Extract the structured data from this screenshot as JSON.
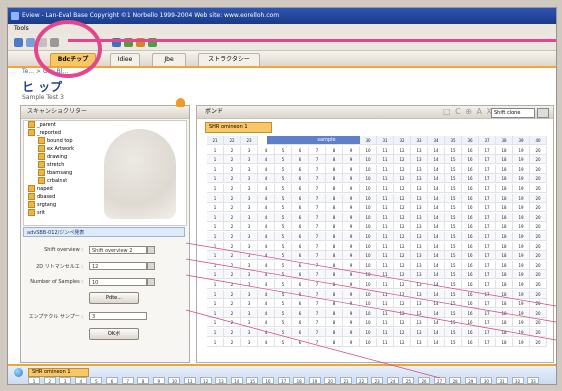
{
  "window": {
    "title": "Eview - Lan-Eval Base  Copyright ©1 Norbello 1999-2004  Web site: www.eorelloh.com"
  },
  "menu": {
    "items": [
      "Tools"
    ]
  },
  "tabs": [
    {
      "label": "Bdcチップ",
      "active": true
    },
    {
      "label": "Idiee",
      "active": false
    },
    {
      "label": "Jbe",
      "active": false
    },
    {
      "label": "ストラクタシー",
      "active": false
    }
  ],
  "breadcrumb": "Te... > Gov Bl...",
  "page": {
    "title": "ヒ ップ",
    "subtitle": "Sample Test 3"
  },
  "left_panel": {
    "header": "スキャンショクリター",
    "tree": [
      {
        "label": "_parent",
        "indent": 0
      },
      {
        "label": "_reported",
        "indent": 0
      },
      {
        "label": "bound top",
        "indent": 1
      },
      {
        "label": "ex Artwork",
        "indent": 1
      },
      {
        "label": "drawing",
        "indent": 1
      },
      {
        "label": "stretch",
        "indent": 1
      },
      {
        "label": "tbarnsang",
        "indent": 1
      },
      {
        "label": "crbalnst",
        "indent": 1
      },
      {
        "label": "naped",
        "indent": 0
      },
      {
        "label": "dbased",
        "indent": 0
      },
      {
        "label": "srgtang",
        "indent": 0
      },
      {
        "label": "srit",
        "indent": 0
      }
    ],
    "selection": "advSBB-012/ジンペ発表",
    "form": {
      "fields": [
        {
          "label": "Shift overview :",
          "value": "Shift overview 2"
        },
        {
          "label": "2D リトマンセルエ :",
          "value": "12"
        },
        {
          "label": "Number of Samples :",
          "value": "10"
        }
      ],
      "preview_button": "Pdte...",
      "sample_label": "エンプテクル サンプー :",
      "sample_value": "3",
      "ok_button": "OKボ"
    }
  },
  "right_panel": {
    "header": "ボンド",
    "tools_label": "□ C ⊕ A X",
    "select_value": "Shift clone",
    "tab_label": "SHR omineon 1",
    "column_header_label": "sample",
    "columns": [
      "1",
      "2",
      "3",
      "4",
      "5",
      "6",
      "7",
      "8",
      "9",
      "10",
      "11",
      "12",
      "13",
      "14",
      "15",
      "16",
      "17",
      "18",
      "19",
      "20",
      "21",
      "22",
      "23",
      "24",
      "25",
      "26",
      "27",
      "28",
      "29",
      "30",
      "31",
      "32",
      "33",
      "34",
      "35",
      "36",
      "37",
      "38",
      "39",
      "40"
    ],
    "row_count": 22
  },
  "bottom": {
    "tab_label": "SHR omineon 1",
    "cells": [
      "1",
      "2",
      "3",
      "4",
      "5",
      "6",
      "7",
      "8",
      "9",
      "10",
      "11",
      "12",
      "13",
      "14",
      "15",
      "16",
      "17",
      "18",
      "19",
      "20",
      "21",
      "22",
      "23",
      "24",
      "25",
      "26",
      "27",
      "28",
      "29",
      "30",
      "31",
      "32",
      "33"
    ]
  }
}
